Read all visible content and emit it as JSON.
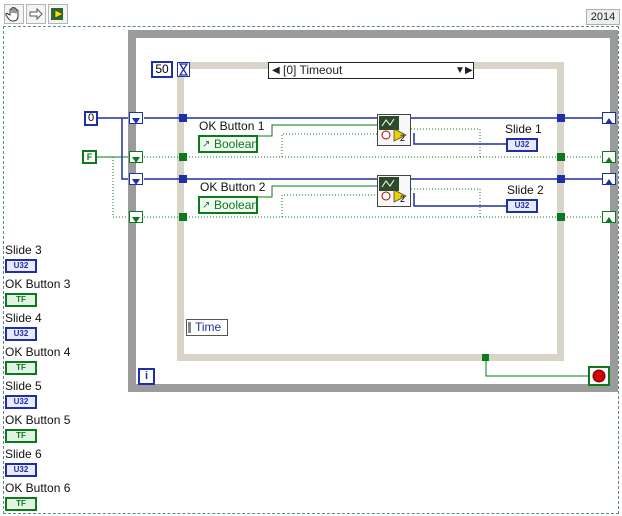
{
  "toolbar": {
    "icons": [
      "hand-tool-icon",
      "step-arrow-icon",
      "highlight-execution-icon"
    ]
  },
  "year_label": "2014",
  "while_loop": {
    "iteration_label": "i",
    "timeout_constant": "50"
  },
  "case_structure": {
    "selector_label": "[0] Timeout",
    "time_indicator": "Time"
  },
  "constants": {
    "numeric_zero": "0",
    "boolean_false": "F"
  },
  "case_controls": [
    {
      "label": "OK Button 1",
      "control_text": "Boolean",
      "slide_label": "Slide 1",
      "subvi_index": "2"
    },
    {
      "label": "OK Button 2",
      "control_text": "Boolean",
      "slide_label": "Slide 2",
      "subvi_index": "2"
    }
  ],
  "terminal_text": {
    "u32": "U32",
    "tf": "TF"
  },
  "left_terminals": [
    {
      "label": "Slide 3",
      "kind": "u32"
    },
    {
      "label": "OK Button 3",
      "kind": "tf"
    },
    {
      "label": "Slide 4",
      "kind": "u32"
    },
    {
      "label": "OK Button 4",
      "kind": "tf"
    },
    {
      "label": "Slide 5",
      "kind": "u32"
    },
    {
      "label": "OK Button 5",
      "kind": "tf"
    },
    {
      "label": "Slide 6",
      "kind": "u32"
    },
    {
      "label": "OK Button 6",
      "kind": "tf"
    }
  ],
  "colors": {
    "numeric_wire": "#1f2fa6",
    "boolean_wire": "#0b7a1d",
    "stop_button": "#d00000"
  }
}
